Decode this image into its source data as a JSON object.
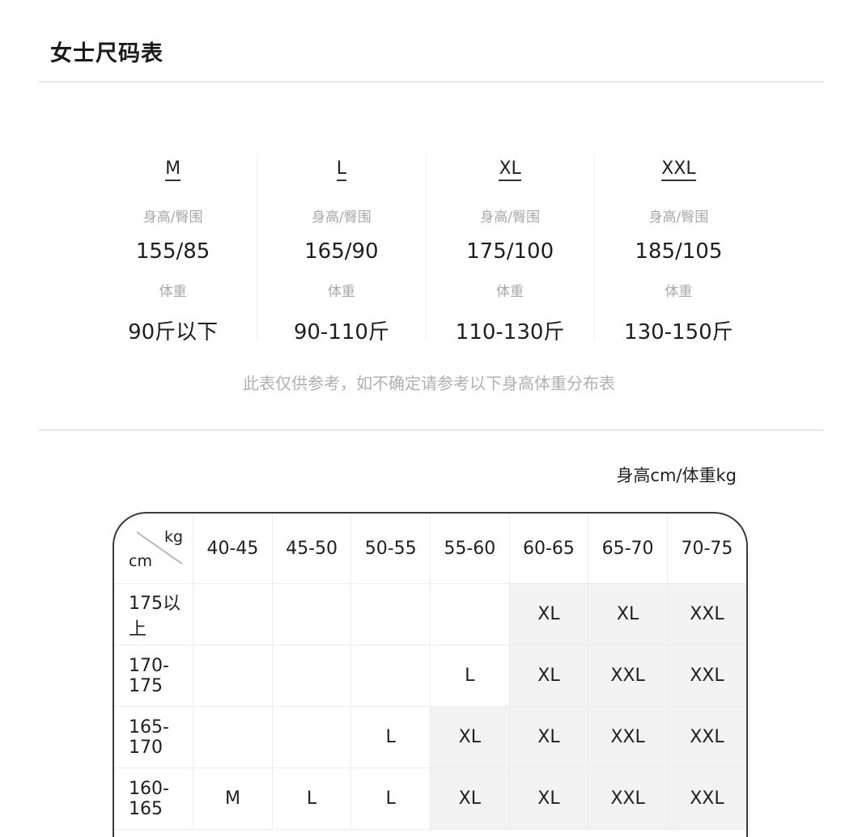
{
  "title": "女士尺码表",
  "size_columns": [
    {
      "size": "M",
      "label1": "身高/臀围",
      "value1": "155/85",
      "label2": "体重",
      "value2": "90斤以下"
    },
    {
      "size": "L",
      "label1": "身高/臀围",
      "value1": "165/90",
      "label2": "体重",
      "value2": "90-110斤"
    },
    {
      "size": "XL",
      "label1": "身高/臀围",
      "value1": "175/100",
      "label2": "体重",
      "value2": "110-130斤"
    },
    {
      "size": "XXL",
      "label1": "身高/臀围",
      "value1": "185/105",
      "label2": "体重",
      "value2": "130-150斤"
    }
  ],
  "note": "此表仅供参考，如不确定请参考以下身高体重分布表",
  "table_caption": "身高cm/体重kg",
  "table": {
    "corner_kg": "kg",
    "corner_cm": "cm",
    "columns": [
      "40-45",
      "45-50",
      "50-55",
      "55-60",
      "60-65",
      "65-70",
      "70-75"
    ],
    "rows": [
      {
        "height": "175以上",
        "cells": [
          "",
          "",
          "",
          "",
          "XL",
          "XL",
          "XXL"
        ]
      },
      {
        "height": "170-175",
        "cells": [
          "",
          "",
          "",
          "L",
          "XL",
          "XXL",
          "XXL"
        ]
      },
      {
        "height": "165-170",
        "cells": [
          "",
          "",
          "L",
          "XL",
          "XL",
          "XXL",
          "XXL"
        ]
      },
      {
        "height": "160-165",
        "cells": [
          "M",
          "L",
          "L",
          "XL",
          "XL",
          "XXL",
          "XXL"
        ]
      }
    ]
  },
  "colors": {
    "shade": "#f3f3f3",
    "border": "#3a3a3a",
    "muted": "#a8a8a8"
  }
}
